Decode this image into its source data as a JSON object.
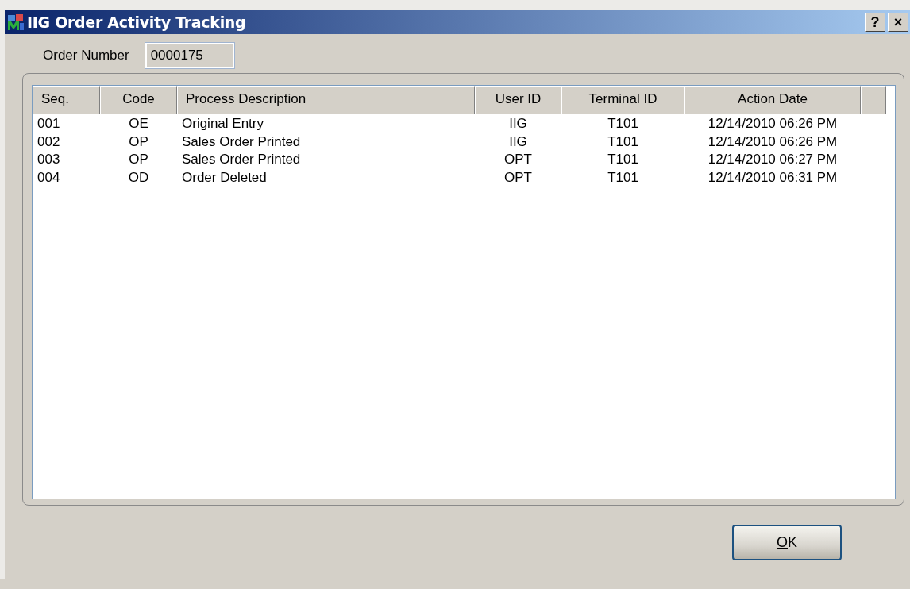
{
  "window": {
    "title": "IIG Order Activity Tracking",
    "buttons": [
      "?",
      "×"
    ]
  },
  "order_number": {
    "label": "Order Number",
    "value": "0000175"
  },
  "table": {
    "columns": [
      "Seq.",
      "Code",
      "Process Description",
      "User ID",
      "Terminal ID",
      "Action Date"
    ],
    "rows": [
      [
        "001",
        "OE",
        "Original Entry",
        "IIG",
        "T101",
        "12/14/2010 06:26 PM"
      ],
      [
        "002",
        "OP",
        "Sales Order Printed",
        "IIG",
        "T101",
        "12/14/2010 06:26 PM"
      ],
      [
        "003",
        "OP",
        "Sales Order Printed",
        "OPT",
        "T101",
        "12/14/2010 06:27 PM"
      ],
      [
        "004",
        "OD",
        "Order Deleted",
        "OPT",
        "T101",
        "12/14/2010 06:31 PM"
      ]
    ]
  },
  "buttons": [
    {
      "label": "OK"
    }
  ]
}
